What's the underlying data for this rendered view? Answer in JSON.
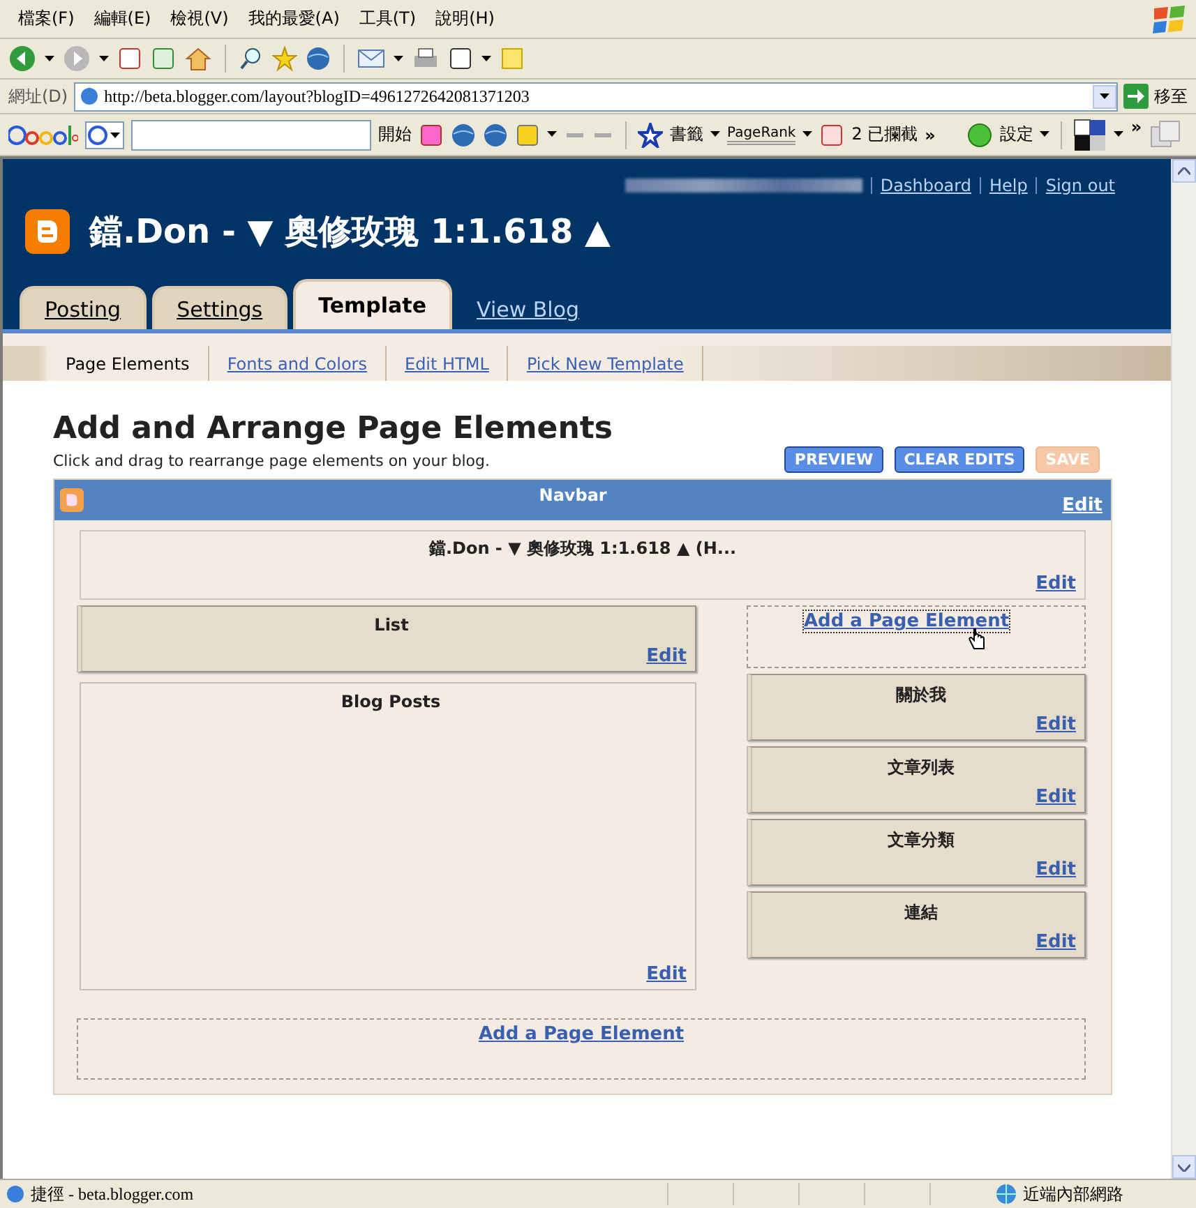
{
  "menu_bar": [
    "檔案(F)",
    "編輯(E)",
    "檢視(V)",
    "我的最愛(A)",
    "工具(T)",
    "說明(H)"
  ],
  "address_bar": {
    "label": "網址(D)",
    "url": "http://beta.blogger.com/layout?blogID=4961272642081371203",
    "go": "移至"
  },
  "google_toolbar": {
    "search_button": "開始",
    "bookmarks": "書籤",
    "pagerank": "PageRank",
    "blocked": "2 已攔截",
    "more": "»",
    "settings": "設定",
    "more_right": "»"
  },
  "header": {
    "links": [
      "Dashboard",
      "Help",
      "Sign out"
    ],
    "blog_title": "鐺.Don - ▼ 奧修玫瑰 1:1.618 ▲"
  },
  "tabs": [
    {
      "label": "Posting",
      "selected": false
    },
    {
      "label": "Settings",
      "selected": false
    },
    {
      "label": "Template",
      "selected": true
    }
  ],
  "view_blog": "View Blog",
  "subtabs": [
    {
      "label": "Page Elements",
      "selected": true
    },
    {
      "label": "Fonts and Colors",
      "selected": false
    },
    {
      "label": "Edit HTML",
      "selected": false
    },
    {
      "label": "Pick New Template",
      "selected": false
    }
  ],
  "heading": "Add and Arrange Page Elements",
  "subheading": "Click and drag to rearrange page elements on your blog.",
  "buttons": [
    {
      "label": "PREVIEW",
      "disabled": false
    },
    {
      "label": "CLEAR EDITS",
      "disabled": false
    },
    {
      "label": "SAVE",
      "disabled": true
    }
  ],
  "layout": {
    "navbar": {
      "title": "Navbar",
      "edit": "Edit"
    },
    "header_widget": {
      "title": "鐺.Don - ▼ 奧修玫瑰 1:1.618 ▲ (H...",
      "edit": "Edit"
    },
    "main": [
      {
        "title": "List",
        "edit": "Edit",
        "kind": "widget"
      },
      {
        "title": "Blog Posts",
        "edit": "Edit",
        "kind": "posts"
      }
    ],
    "sidebar_add": "Add a Page Element",
    "sidebar": [
      {
        "title": "關於我",
        "edit": "Edit"
      },
      {
        "title": "文章列表",
        "edit": "Edit"
      },
      {
        "title": "文章分類",
        "edit": "Edit"
      },
      {
        "title": "連結",
        "edit": "Edit"
      }
    ],
    "bottom_add": "Add a Page Element"
  },
  "status_bar": {
    "text": "捷徑 - beta.blogger.com",
    "zone": "近端內部網路"
  }
}
